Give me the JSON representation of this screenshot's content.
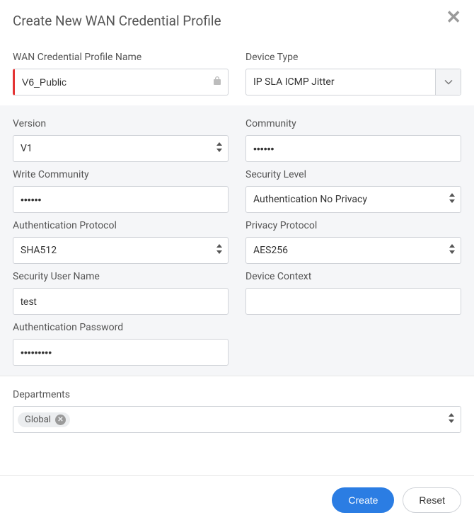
{
  "header": {
    "title": "Create New WAN Credential Profile"
  },
  "top": {
    "profile_name_label": "WAN Credential Profile Name",
    "profile_name_value": "V6_Public",
    "device_type_label": "Device Type",
    "device_type_value": "IP SLA ICMP Jitter"
  },
  "mid": {
    "version_label": "Version",
    "version_value": "V1",
    "community_label": "Community",
    "community_value": "••••••",
    "write_community_label": "Write Community",
    "write_community_value": "••••••",
    "security_level_label": "Security Level",
    "security_level_value": "Authentication No Privacy",
    "auth_protocol_label": "Authentication Protocol",
    "auth_protocol_value": "SHA512",
    "privacy_protocol_label": "Privacy Protocol",
    "privacy_protocol_value": "AES256",
    "security_user_label": "Security User Name",
    "security_user_value": "test",
    "device_context_label": "Device Context",
    "device_context_value": "",
    "auth_password_label": "Authentication Password",
    "auth_password_value": "•••••••••"
  },
  "departments": {
    "label": "Departments",
    "tag": "Global"
  },
  "footer": {
    "create_label": "Create",
    "reset_label": "Reset"
  }
}
